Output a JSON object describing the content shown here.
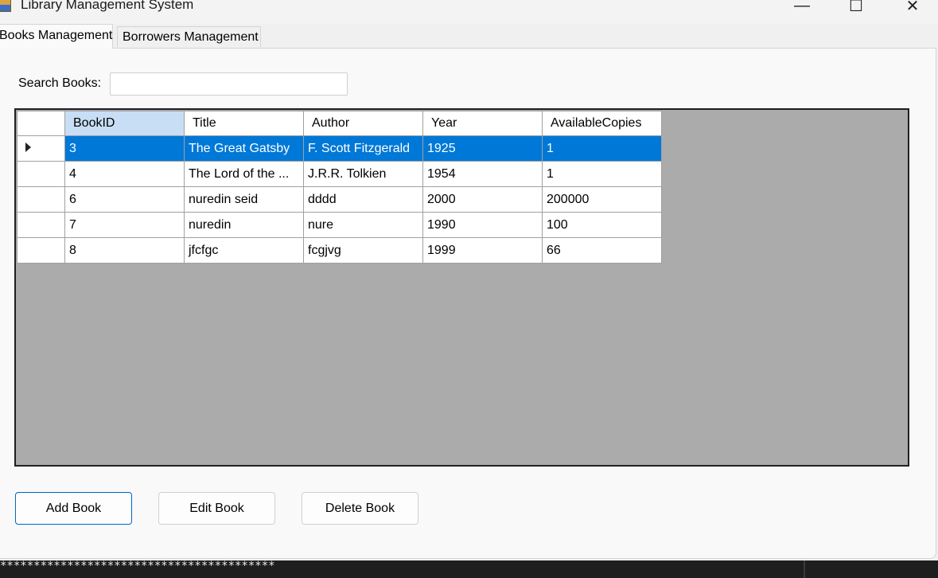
{
  "window": {
    "title": "Library Management System",
    "controls": {
      "minimize": "—",
      "maximize": "☐",
      "close": "✕"
    }
  },
  "tabs": [
    {
      "label": "Books Management",
      "active": true
    },
    {
      "label": "Borrowers Management",
      "active": false
    }
  ],
  "search": {
    "label": "Search Books:",
    "value": ""
  },
  "grid": {
    "columns": [
      "BookID",
      "Title",
      "Author",
      "Year",
      "AvailableCopies"
    ],
    "selected_row": 0,
    "rows": [
      [
        "3",
        "The Great Gatsby",
        "F. Scott Fitzgerald",
        "1925",
        "1"
      ],
      [
        "4",
        "The Lord of the ...",
        "J.R.R. Tolkien",
        "1954",
        "1"
      ],
      [
        "6",
        "nuredin seid",
        "dddd",
        "2000",
        "200000"
      ],
      [
        "7",
        "nuredin",
        "nure",
        "1990",
        "100"
      ],
      [
        "8",
        "jfcfgc",
        "fcgjvg",
        "1999",
        "66"
      ]
    ]
  },
  "buttons": {
    "add": "Add Book",
    "edit": "Edit Book",
    "delete": "Delete Book"
  },
  "console": {
    "text": "*****************************************"
  },
  "colors": {
    "selection": "#0078d7",
    "sorted_header": "#c7def5",
    "grid_background": "#ababab",
    "default_button_border": "#0067c0"
  }
}
